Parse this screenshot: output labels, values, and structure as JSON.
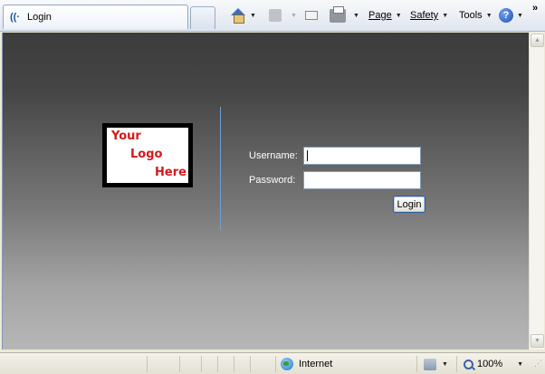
{
  "browser": {
    "tab": {
      "title": "Login"
    },
    "command_bar": {
      "page_label": "Page",
      "safety_label": "Safety",
      "tools_label": "Tools",
      "overflow_label": "»"
    },
    "status_bar": {
      "zone_label": "Internet",
      "zoom_label": "100%"
    }
  },
  "page": {
    "logo": {
      "line1": "Your",
      "line2": "Logo",
      "line3": "Here"
    },
    "form": {
      "username_label": "Username:",
      "username_value": "",
      "password_label": "Password:",
      "password_value": "",
      "login_button": "Login"
    }
  },
  "colors": {
    "logo_text": "#d41818",
    "divider": "#6da0cf",
    "label_text": "#ffffff",
    "button_border": "#2a5ba6"
  },
  "icons": [
    "feed-tab-icon",
    "new-tab-icon",
    "home-icon",
    "feeds-icon",
    "mail-icon",
    "print-icon",
    "help-icon",
    "globe-icon",
    "protected-mode-icon",
    "zoom-icon"
  ]
}
